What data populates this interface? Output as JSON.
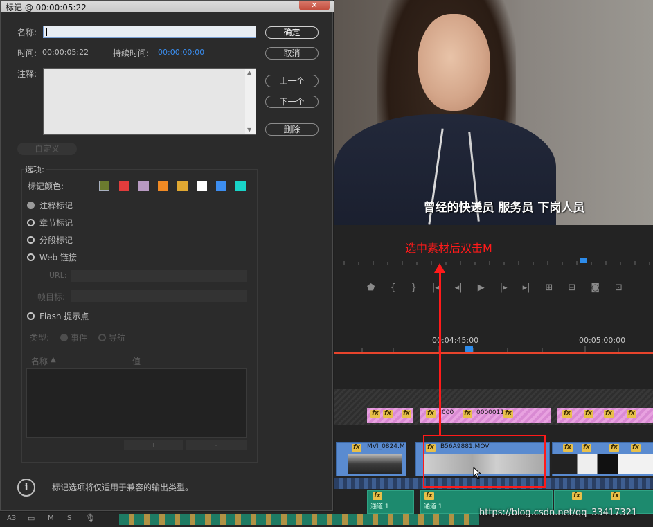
{
  "dialog": {
    "title": "标记 @ 00:00:05:22",
    "close_label": "✕",
    "name_label": "名称:",
    "name_value": "",
    "time_label": "时间:",
    "time_value": "00:00:05:22",
    "duration_label": "持续时间:",
    "duration_value": "00:00:00:00",
    "notes_label": "注释:",
    "buttons": {
      "ok": "确定",
      "cancel": "取消",
      "prev": "上一个",
      "next": "下一个",
      "delete": "删除"
    },
    "custom_label": "自定义",
    "options_title": "选项:",
    "marker_color_label": "标记颜色:",
    "marker_colors": [
      "#6b7a2e",
      "#e23c3c",
      "#b89ac2",
      "#f08a24",
      "#e0a832",
      "#ffffff",
      "#3d8ef0",
      "#19d4c8"
    ],
    "marker_types": [
      {
        "label": "注释标记",
        "selected": true
      },
      {
        "label": "章节标记",
        "selected": false
      },
      {
        "label": "分段标记",
        "selected": false
      },
      {
        "label": "Web 链接",
        "selected": false
      }
    ],
    "url_label": "URL:",
    "frame_target_label": "帧目标:",
    "flash_label": "Flash 提示点",
    "type_label": "类型:",
    "type_options": [
      "事件",
      "导航"
    ],
    "table_headers": {
      "name": "名称",
      "value": "值"
    },
    "table_add": "+",
    "table_remove": "-",
    "footer_text": "标记选项将仅适用于兼容的输出类型。",
    "info_icon_glyph": "i"
  },
  "preview": {
    "subtitle": "曾经的快递员 服务员 下岗人员"
  },
  "annotation": {
    "text": "选中素材后双击M",
    "color": "#ff1a1a"
  },
  "timeline": {
    "time_labels": [
      "00:04:45:00",
      "00:05:00:00"
    ],
    "clips": {
      "v1_a": "MVI_0824.M",
      "v1_b": "B56A9881.MOV",
      "pink_a": "000",
      "pink_b": "0000011"
    },
    "audio_label": "通道 1",
    "track_headers": [
      "A3",
      "M",
      "S"
    ]
  },
  "watermark": "https://blog.csdn.net/qq_33417321"
}
